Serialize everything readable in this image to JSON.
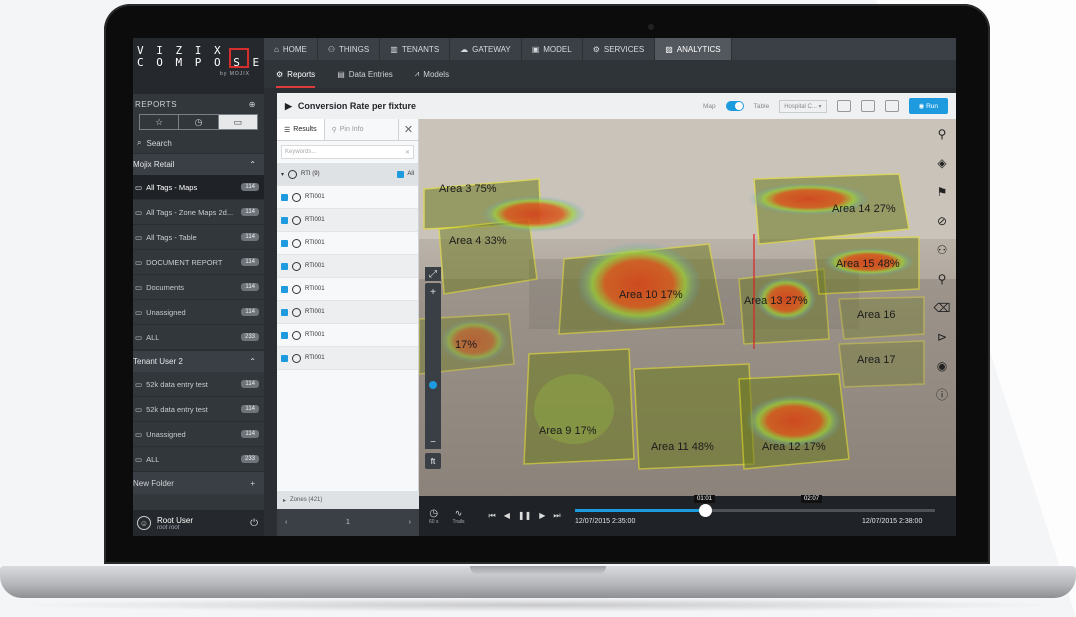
{
  "sidebar": {
    "logo": {
      "line1": "V I Z I X",
      "line2": "C O M P O S E R",
      "by": "by MOJIX"
    },
    "section_title": "REPORTS",
    "search_label": "Search",
    "groups": [
      {
        "name": "Mojix Retail",
        "items": [
          {
            "label": "All Tags - Maps",
            "count": "114",
            "active": true
          },
          {
            "label": "All Tags - Zone Maps 2d...",
            "count": "114"
          },
          {
            "label": "All Tags - Table",
            "count": "114"
          },
          {
            "label": "DOCUMENT REPORT",
            "count": "114"
          },
          {
            "label": "Documents",
            "count": "114"
          },
          {
            "label": "Unassigned",
            "count": "114"
          },
          {
            "label": "ALL",
            "count": "233"
          }
        ]
      },
      {
        "name": "Tenant User 2",
        "items": [
          {
            "label": "52k data entry test",
            "count": "114"
          },
          {
            "label": "52k data entry test",
            "count": "114"
          },
          {
            "label": "Unassigned",
            "count": "114"
          },
          {
            "label": "ALL",
            "count": "233"
          }
        ]
      }
    ],
    "new_folder": "New Folder",
    "user": {
      "name": "Root User",
      "sub": "root root"
    }
  },
  "topnav": [
    {
      "label": "HOME",
      "icon": "home-icon"
    },
    {
      "label": "THINGS",
      "icon": "things-icon"
    },
    {
      "label": "TENANTS",
      "icon": "tenants-icon"
    },
    {
      "label": "GATEWAY",
      "icon": "cloud-icon"
    },
    {
      "label": "MODEL",
      "icon": "model-icon"
    },
    {
      "label": "SERVICES",
      "icon": "services-icon"
    },
    {
      "label": "ANALYTICS",
      "icon": "chart-icon",
      "active": true
    }
  ],
  "subnav": [
    {
      "label": "Reports",
      "active": true
    },
    {
      "label": "Data Entries"
    },
    {
      "label": "Models"
    }
  ],
  "report": {
    "title": "Conversion Rate per fixture",
    "map_label": "Map",
    "table_label": "Table",
    "site_select": "Hospital C...",
    "run_label": "Run"
  },
  "results": {
    "tab_results": "Results",
    "tab_pin": "Pin Info",
    "keywords_placeholder": "Keywords...",
    "head_row": "RTI (9)",
    "all_label": "All",
    "rows": [
      "RTI001",
      "RTI001",
      "RTI001",
      "RTI001",
      "RTI001",
      "RTI001",
      "RTI001",
      "RTI001"
    ],
    "zones": "Zones (421)",
    "pager_page": "1"
  },
  "zones": [
    {
      "label": "Area 3 75%"
    },
    {
      "label": "Area 4 33%"
    },
    {
      "label": "Area 10 17%"
    },
    {
      "label": "Area 13 27%"
    },
    {
      "label": "Area 14 27%"
    },
    {
      "label": "Area 15 48%"
    },
    {
      "label": "Area 16"
    },
    {
      "label": "Area 17"
    },
    {
      "label": "Area 9 17%"
    },
    {
      "label": "Area 11 48%"
    },
    {
      "label": "Area 12 17%"
    },
    {
      "label": "17%"
    }
  ],
  "map_tools": [
    "pin-icon",
    "layers-icon",
    "marker-icon",
    "compass-icon",
    "multi-pin-icon",
    "pin-line-icon",
    "eraser-icon",
    "play-circle-icon",
    "map-icon",
    "info-icon"
  ],
  "zoom": {
    "plus": "+",
    "minus": "−",
    "ft": "ft"
  },
  "playback": {
    "speed": "60 s",
    "trails": "Trails",
    "start_time": "12/07/2015 2:35:00",
    "end_time": "12/07/2015 2:38:00",
    "current_tip": "01:01",
    "hover_tip": "02:07",
    "progress": 0.36
  }
}
